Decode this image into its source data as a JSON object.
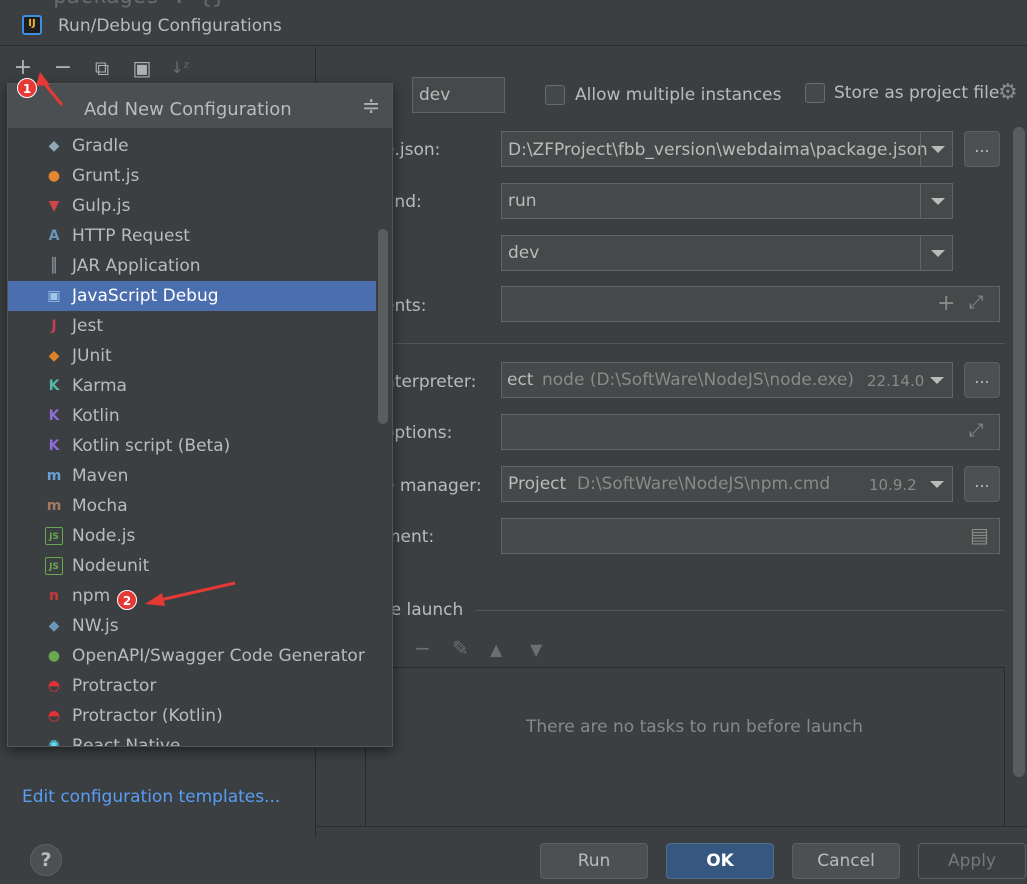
{
  "window": {
    "title": "Run/Debug Configurations",
    "bg_code": "\"packages\": {}"
  },
  "toolbar": {
    "add": "+",
    "remove": "−",
    "copy": "⧉",
    "folder": "▣",
    "sort": "↓ᶻ"
  },
  "popup": {
    "title": "Add New Configuration",
    "items": [
      {
        "label": "Gradle",
        "icon": "gradle-icon",
        "color": "#8fa8b8",
        "glyph": "◆"
      },
      {
        "label": "Grunt.js",
        "icon": "grunt-icon",
        "color": "#e48632",
        "glyph": "●"
      },
      {
        "label": "Gulp.js",
        "icon": "gulp-icon",
        "color": "#cf4647",
        "glyph": "▼"
      },
      {
        "label": "HTTP Request",
        "icon": "api-icon",
        "color": "#6897bb",
        "glyph": "A"
      },
      {
        "label": "JAR Application",
        "icon": "jar-icon",
        "color": "#9aa7b0",
        "glyph": "║"
      },
      {
        "label": "JavaScript Debug",
        "icon": "js-debug-icon",
        "color": "#9ec8ea",
        "glyph": "▣"
      },
      {
        "label": "Jest",
        "icon": "jest-icon",
        "color": "#c63d5a",
        "glyph": "J"
      },
      {
        "label": "JUnit",
        "icon": "junit-icon",
        "color": "#e0822c",
        "glyph": "◆"
      },
      {
        "label": "Karma",
        "icon": "karma-icon",
        "color": "#56b6a7",
        "glyph": "K"
      },
      {
        "label": "Kotlin",
        "icon": "kotlin-icon",
        "color": "#8f6cd8",
        "glyph": "K"
      },
      {
        "label": "Kotlin script (Beta)",
        "icon": "kotlin-script-icon",
        "color": "#8f6cd8",
        "glyph": "K"
      },
      {
        "label": "Maven",
        "icon": "maven-icon",
        "color": "#6a9fd4",
        "glyph": "m"
      },
      {
        "label": "Mocha",
        "icon": "mocha-icon",
        "color": "#a37b60",
        "glyph": "m"
      },
      {
        "label": "Node.js",
        "icon": "nodejs-icon",
        "color": "#6aa84f",
        "glyph": "JS"
      },
      {
        "label": "Nodeunit",
        "icon": "nodeunit-icon",
        "color": "#6aa84f",
        "glyph": "JS"
      },
      {
        "label": "npm",
        "icon": "npm-icon",
        "color": "#cb3837",
        "glyph": "n"
      },
      {
        "label": "NW.js",
        "icon": "nwjs-icon",
        "color": "#6897bb",
        "glyph": "◆"
      },
      {
        "label": "OpenAPI/Swagger Code Generator",
        "icon": "openapi-icon",
        "color": "#6aa84f",
        "glyph": "●"
      },
      {
        "label": "Protractor",
        "icon": "protractor-icon",
        "color": "#e23237",
        "glyph": "◓"
      },
      {
        "label": "Protractor (Kotlin)",
        "icon": "protractor-kotlin-icon",
        "color": "#e23237",
        "glyph": "◓"
      },
      {
        "label": "React Native",
        "icon": "react-native-icon",
        "color": "#61dafb",
        "glyph": "✺"
      }
    ],
    "selected_index": 5
  },
  "left": {
    "edit_templates": "Edit configuration templates..."
  },
  "form": {
    "name_value": "dev",
    "allow_multiple": "Allow multiple instances",
    "store_as_project": "Store as project file",
    "package_json_label": "e.json:",
    "package_json_value": "D:\\ZFProject\\fbb_version\\webdaima\\package.json",
    "command_label": "and:",
    "command_value": "run",
    "scripts_value": "dev",
    "arguments_label": "ents:",
    "interpreter_label": "nterpreter:",
    "interpreter_prefix": "ect",
    "interpreter_path": "node (D:\\SoftWare\\NodeJS\\node.exe)",
    "interpreter_version": "22.14.0",
    "options_label": "options:",
    "package_manager_label": "e manager:",
    "package_manager_prefix": "Project",
    "package_manager_path": "D:\\SoftWare\\NodeJS\\npm.cmd",
    "package_manager_version": "10.9.2",
    "environment_label": "ment:",
    "before_launch": "re launch",
    "no_tasks": "There are no tasks to run before launch"
  },
  "buttons": {
    "run": "Run",
    "ok": "OK",
    "cancel": "Cancel",
    "apply": "Apply",
    "help": "?",
    "dots": "..."
  },
  "annotations": {
    "one": "1",
    "two": "2",
    "arrow_color": "#e53935"
  }
}
